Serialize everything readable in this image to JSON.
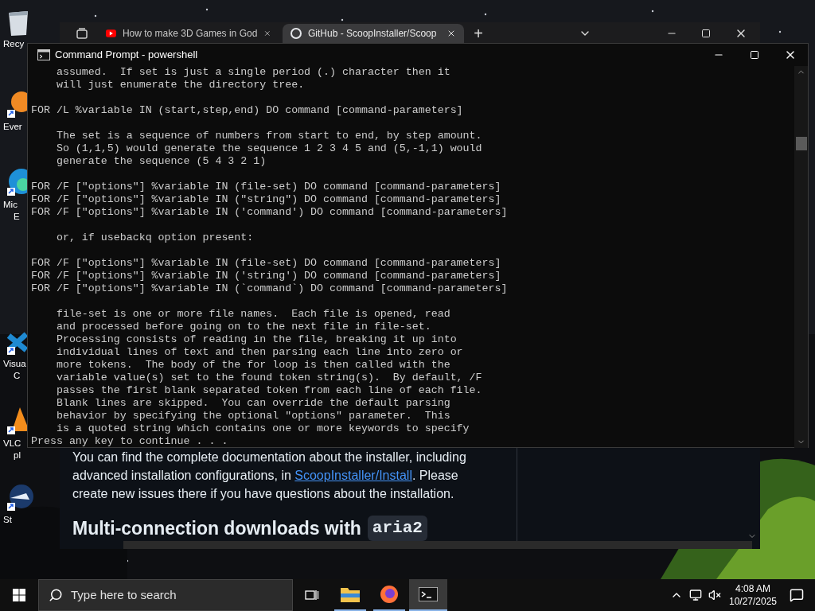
{
  "desktop": {
    "icons": [
      {
        "kind": "recycle-bin",
        "label": [
          "Recy"
        ]
      },
      {
        "kind": "evernote",
        "label": [
          "Ever"
        ]
      },
      {
        "kind": "edge",
        "label": [
          "Mic",
          "E"
        ]
      },
      {
        "kind": "vscode",
        "label": [
          "Visua",
          "C"
        ]
      },
      {
        "kind": "vlc",
        "label": [
          "VLC",
          "pl"
        ]
      },
      {
        "kind": "steam",
        "label": [
          "St"
        ]
      }
    ]
  },
  "browser": {
    "tabs": [
      {
        "title": "How to make 3D Games in God",
        "selected": false
      },
      {
        "title": "GitHub - ScoopInstaller/Scoop",
        "selected": true
      }
    ],
    "new_tab": "+",
    "content": {
      "paragraph_start": "You can find the complete documentation about the installer, including advanced installation configurations, in ",
      "link": "ScoopInstaller/Install",
      "paragraph_end": ". Please create new issues there if you have questions about the installation.",
      "heading": "Multi-connection downloads with",
      "heading_code": "aria2"
    }
  },
  "terminal": {
    "title": "Command Prompt - powershell",
    "blocks": [
      [
        "    assumed.  If set is just a single period (.) character then it",
        "    will just enumerate the directory tree."
      ],
      [
        "FOR /L %variable IN (start,step,end) DO command [command-parameters]"
      ],
      [
        "    The set is a sequence of numbers from start to end, by step amount.",
        "    So (1,1,5) would generate the sequence 1 2 3 4 5 and (5,-1,1) would",
        "    generate the sequence (5 4 3 2 1)"
      ],
      [
        "FOR /F [\"options\"] %variable IN (file-set) DO command [command-parameters]",
        "FOR /F [\"options\"] %variable IN (\"string\") DO command [command-parameters]",
        "FOR /F [\"options\"] %variable IN ('command') DO command [command-parameters]"
      ],
      [
        "    or, if usebackq option present:"
      ],
      [
        "FOR /F [\"options\"] %variable IN (file-set) DO command [command-parameters]",
        "FOR /F [\"options\"] %variable IN ('string') DO command [command-parameters]",
        "FOR /F [\"options\"] %variable IN (`command`) DO command [command-parameters]"
      ],
      [
        "    file-set is one or more file names.  Each file is opened, read",
        "    and processed before going on to the next file in file-set.",
        "    Processing consists of reading in the file, breaking it up into",
        "    individual lines of text and then parsing each line into zero or",
        "    more tokens.  The body of the for loop is then called with the",
        "    variable value(s) set to the found token string(s).  By default, /F",
        "    passes the first blank separated token from each line of each file.",
        "    Blank lines are skipped.  You can override the default parsing",
        "    behavior by specifying the optional \"options\" parameter.  This",
        "    is a quoted string which contains one or more keywords to specify"
      ]
    ],
    "prompt": "Press any key to continue . . ."
  },
  "taskbar": {
    "search": {
      "placeholder": "Type here to search"
    },
    "apps": [
      {
        "kind": "file-explorer",
        "running": true,
        "selected": false
      },
      {
        "kind": "firefox",
        "running": true,
        "selected": false
      },
      {
        "kind": "terminal",
        "running": true,
        "selected": true
      }
    ],
    "time": "4:08 AM",
    "date": "10/27/2025"
  }
}
